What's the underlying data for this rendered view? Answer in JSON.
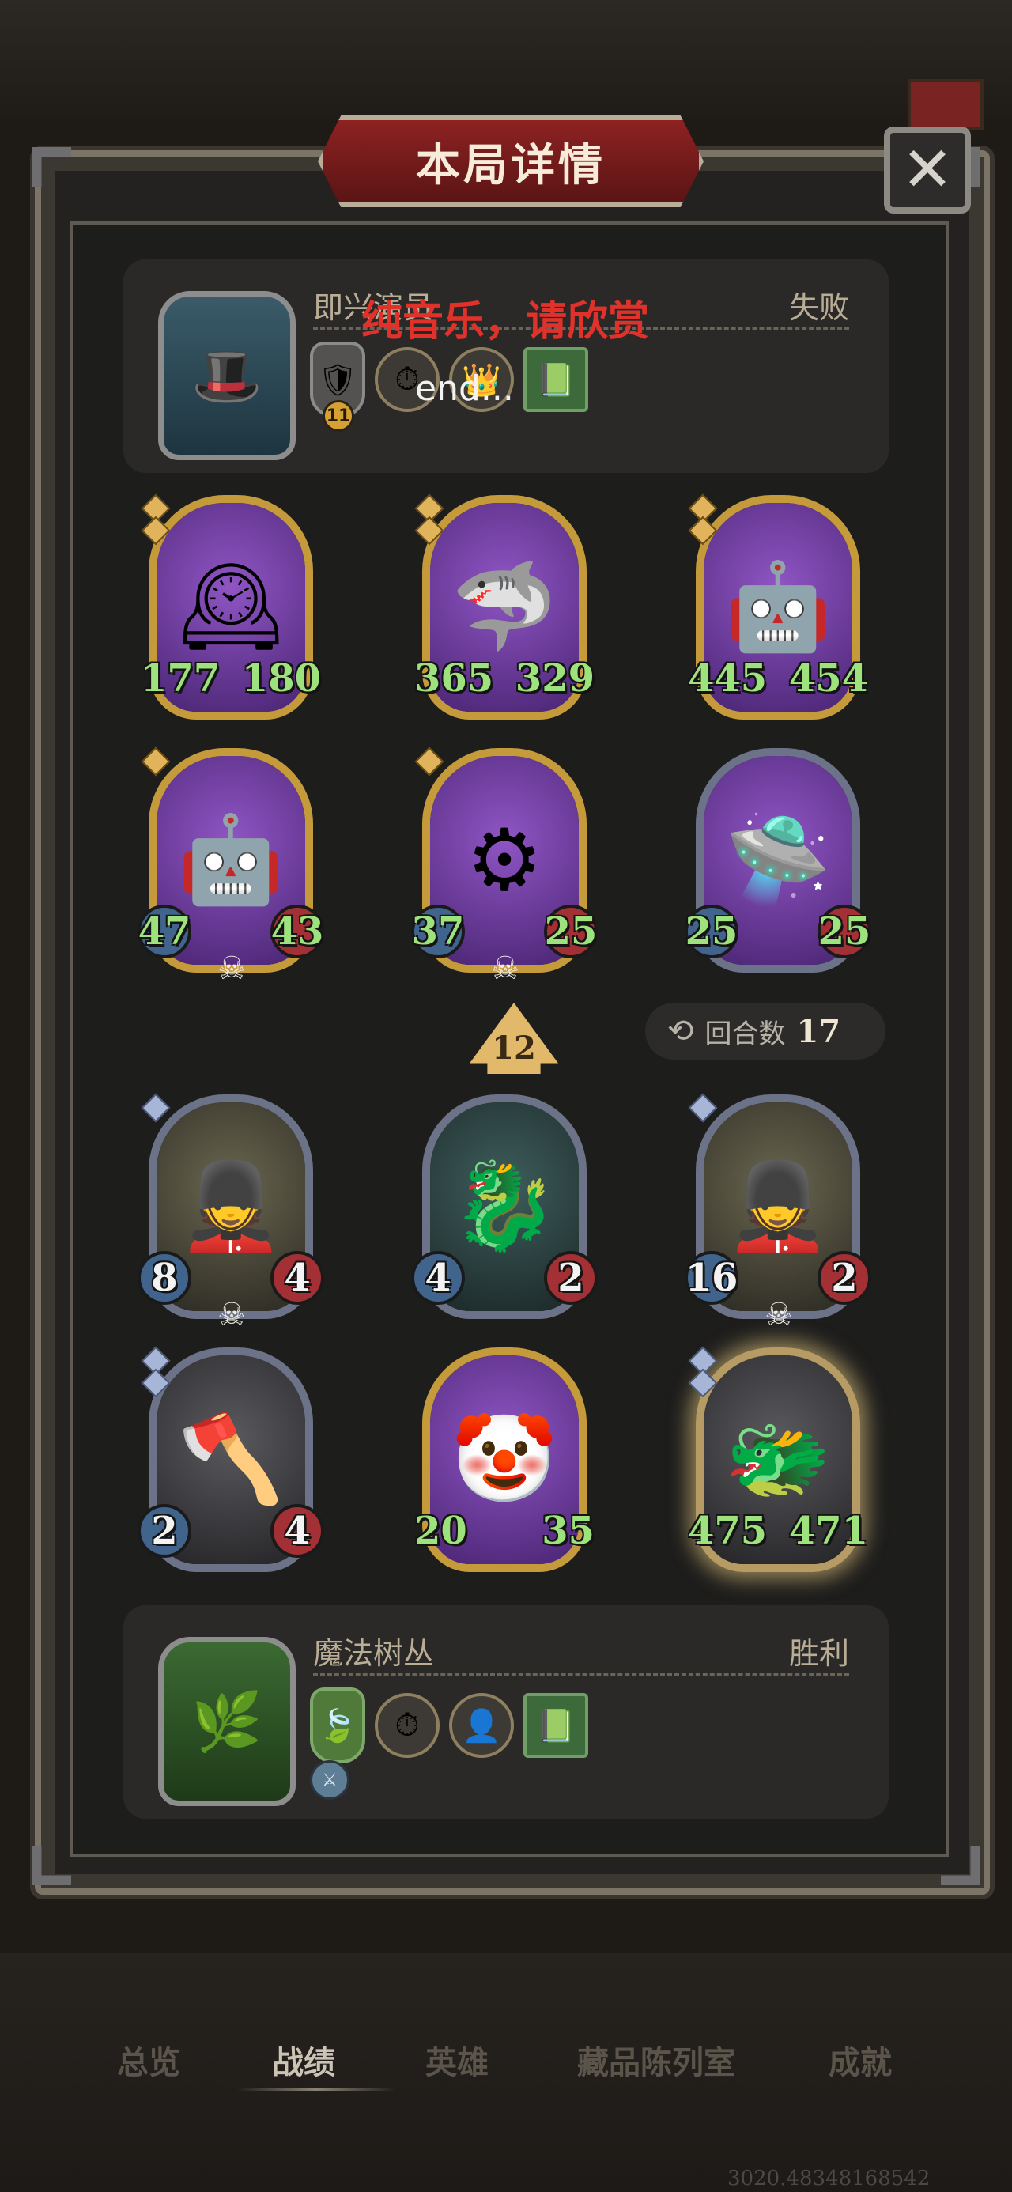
{
  "modal": {
    "title": "本局详情",
    "close_icon": "✕"
  },
  "overlays": {
    "red_text": "纯音乐，请欣赏",
    "white_text": "end..."
  },
  "opponent": {
    "name": "即兴演员",
    "result": "失败",
    "level": "11"
  },
  "player": {
    "name": "魔法树丛",
    "result": "胜利"
  },
  "opponent_board": [
    {
      "atk": "177",
      "hp": "180",
      "art": "clock-monster"
    },
    {
      "atk": "365",
      "hp": "329",
      "art": "fang-beast"
    },
    {
      "atk": "445",
      "hp": "454",
      "art": "laser-robot"
    },
    {
      "atk": "47",
      "hp": "43",
      "art": "twin-robots",
      "dead": "☠"
    },
    {
      "atk": "37",
      "hp": "25",
      "art": "robot-stack",
      "dead": "☠"
    },
    {
      "atk": "25",
      "hp": "25",
      "art": "mech-drone"
    }
  ],
  "player_board": [
    {
      "atk": "8",
      "hp": "4",
      "art": "toy-soldier",
      "dead": "☠"
    },
    {
      "atk": "4",
      "hp": "2",
      "art": "ghost-dragon"
    },
    {
      "atk": "16",
      "hp": "2",
      "art": "toy-soldier",
      "dead": "☠"
    },
    {
      "atk": "2",
      "hp": "4",
      "art": "barbarian"
    },
    {
      "atk": "20",
      "hp": "35",
      "art": "clown"
    },
    {
      "atk": "475",
      "hp": "471",
      "art": "green-dragon"
    }
  ],
  "turn": {
    "damage": "12",
    "rounds_label": "回合数",
    "rounds_value": "17"
  },
  "tabs": [
    "总览",
    "战绩",
    "英雄",
    "藏品陈列室",
    "成就"
  ],
  "active_tab": "战绩",
  "watermark": "3020.48348168542",
  "colors": {
    "gold_frame": "#c59a3a",
    "silver_frame": "#6c7389",
    "atk_blue": "#40648c",
    "hp_red": "#a23034",
    "stat_green": "#9de27c"
  }
}
